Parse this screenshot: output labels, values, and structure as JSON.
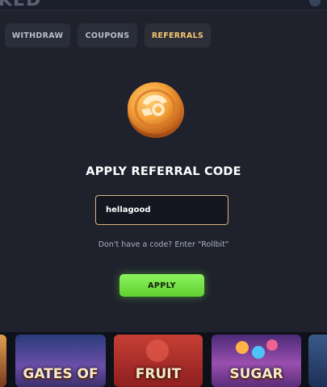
{
  "background": {
    "top_text": "KED"
  },
  "tabs": [
    {
      "label": "WITHDRAW",
      "active": false
    },
    {
      "label": "COUPONS",
      "active": false
    },
    {
      "label": "REFERRALS",
      "active": true
    }
  ],
  "modal": {
    "title": "APPLY REFERRAL CODE",
    "input_value": "hellagood",
    "hint": "Don't have a code? Enter \"Rollbit\"",
    "apply_label": "APPLY"
  },
  "games": [
    {
      "label": ""
    },
    {
      "label": "GATES OF"
    },
    {
      "label": "FRUIT"
    },
    {
      "label": "SUGAR"
    },
    {
      "label": ""
    }
  ],
  "colors": {
    "accent_tab": "#f3c474",
    "apply_button": "#6fe03c",
    "input_border": "#d9b37a",
    "modal_bg": "#1f222d"
  }
}
